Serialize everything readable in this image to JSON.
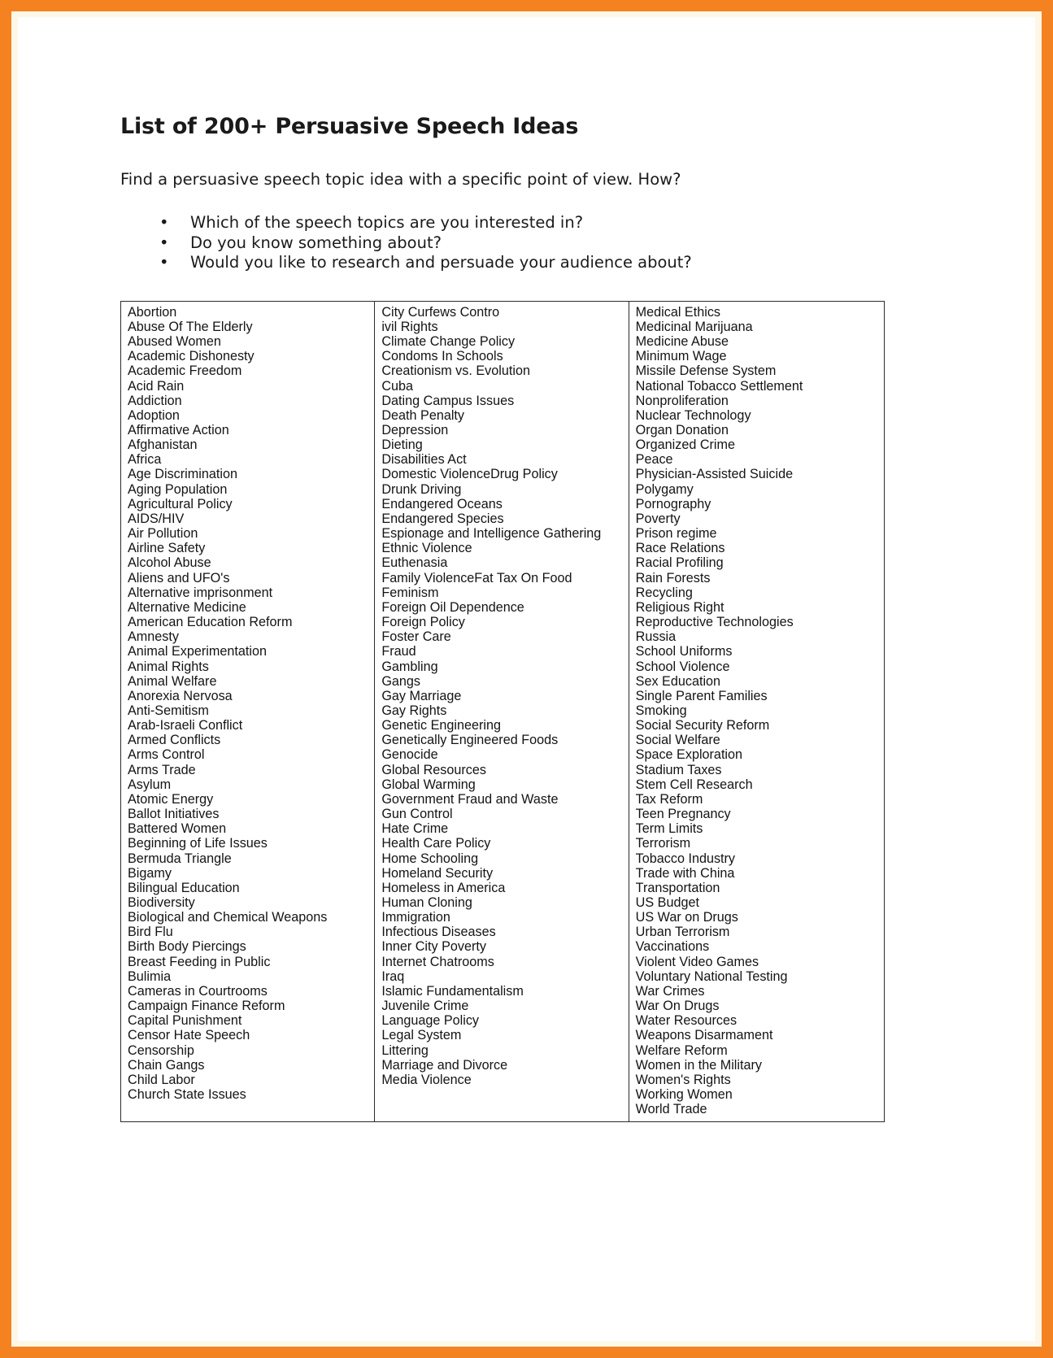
{
  "document": {
    "title": "List of 200+ Persuasive Speech Ideas",
    "intro": "Find a persuasive speech topic idea with a specific point of view. How?",
    "bullet_glyph": "•",
    "questions": [
      "Which of the speech topics are you interested in?",
      "Do you know something about?",
      "Would you like to research and persuade your audience about?"
    ]
  },
  "colors": {
    "page_border": "#f58220",
    "border_inner": "#fdf7e8",
    "paper": "#ffffff",
    "text": "#141414",
    "table_line": "#2b2b2b"
  },
  "topic_table": {
    "columns": [
      {
        "name": "column-1",
        "items": [
          "Abortion",
          "Abuse Of The Elderly",
          "Abused Women",
          "Academic Dishonesty",
          "Academic Freedom",
          "Acid Rain",
          "Addiction",
          "Adoption",
          "Affirmative Action",
          "Afghanistan",
          "Africa",
          "Age Discrimination",
          "Aging Population",
          "Agricultural Policy",
          "AIDS/HIV",
          "Air Pollution",
          "Airline Safety",
          "Alcohol Abuse",
          "Aliens and UFO's",
          "Alternative imprisonment",
          "Alternative Medicine",
          "American Education Reform",
          "Amnesty",
          "Animal Experimentation",
          "Animal Rights",
          "Animal Welfare",
          "Anorexia Nervosa",
          "Anti-Semitism",
          "Arab-Israeli Conflict",
          "Armed Conflicts",
          "Arms Control",
          "Arms Trade",
          "Asylum",
          "Atomic Energy",
          "Ballot Initiatives",
          "Battered Women",
          "Beginning of Life Issues",
          "Bermuda Triangle",
          "Bigamy",
          "Bilingual Education",
          "Biodiversity",
          "Biological and Chemical Weapons",
          "Bird Flu",
          "Birth Body Piercings",
          "Breast Feeding in Public",
          "Bulimia",
          "Cameras in Courtrooms",
          "Campaign Finance Reform",
          "Capital Punishment",
          "Censor Hate Speech",
          "Censorship",
          "Chain Gangs",
          "Child Labor",
          "Church State Issues"
        ]
      },
      {
        "name": "column-2",
        "items": [
          "City Curfews Contro",
          "ivil Rights",
          "Climate Change Policy",
          "Condoms In Schools",
          "Creationism vs. Evolution",
          "Cuba",
          "Dating Campus Issues",
          "Death Penalty",
          "Depression",
          "Dieting",
          "Disabilities Act",
          "Domestic ViolenceDrug Policy",
          "Drunk Driving",
          "Endangered Oceans",
          "Endangered Species",
          "Espionage and Intelligence Gathering",
          "Ethnic Violence",
          "Euthenasia",
          "Family ViolenceFat Tax On Food",
          "Feminism",
          "Foreign Oil Dependence",
          "Foreign Policy",
          "Foster Care",
          "Fraud",
          "Gambling",
          "Gangs",
          "Gay Marriage",
          "Gay Rights",
          "Genetic Engineering",
          "Genetically Engineered Foods",
          "Genocide",
          "Global Resources",
          "Global Warming",
          "Government Fraud and Waste",
          "Gun Control",
          "Hate Crime",
          "Health Care Policy",
          "Home Schooling",
          "Homeland Security",
          "Homeless in America",
          "Human Cloning",
          "Immigration",
          "Infectious Diseases",
          "Inner City Poverty",
          "Internet Chatrooms",
          "Iraq",
          "Islamic Fundamentalism",
          "Juvenile Crime",
          "Language Policy",
          "Legal System",
          "Littering",
          "Marriage and Divorce",
          "Media Violence"
        ]
      },
      {
        "name": "column-3",
        "items": [
          "Medical Ethics",
          "Medicinal Marijuana",
          "Medicine Abuse",
          "Minimum Wage",
          "Missile Defense System",
          "National Tobacco Settlement",
          "Nonproliferation",
          "Nuclear Technology",
          "Organ Donation",
          "Organized Crime",
          "Peace",
          "Physician-Assisted Suicide",
          "Polygamy",
          "Pornography",
          "Poverty",
          "Prison regime",
          "Race Relations",
          "Racial Profiling",
          "Rain Forests",
          "Recycling",
          "Religious Right",
          "Reproductive Technologies",
          "Russia",
          "School Uniforms",
          "School Violence",
          "Sex Education",
          "Single Parent Families",
          "Smoking",
          "Social Security Reform",
          "Social Welfare",
          "Space Exploration",
          "Stadium Taxes",
          "Stem Cell Research",
          "Tax Reform",
          "Teen Pregnancy",
          "Term Limits",
          "Terrorism",
          "Tobacco Industry",
          "Trade with China",
          "Transportation",
          "US Budget",
          "US War on Drugs",
          "Urban Terrorism",
          "Vaccinations",
          "Violent Video Games",
          "Voluntary National Testing",
          "War Crimes",
          "War On Drugs",
          "Water Resources",
          "Weapons Disarmament",
          "Welfare Reform",
          "Women in the Military",
          "Women's Rights",
          "Working Women",
          "World Trade"
        ]
      }
    ]
  }
}
